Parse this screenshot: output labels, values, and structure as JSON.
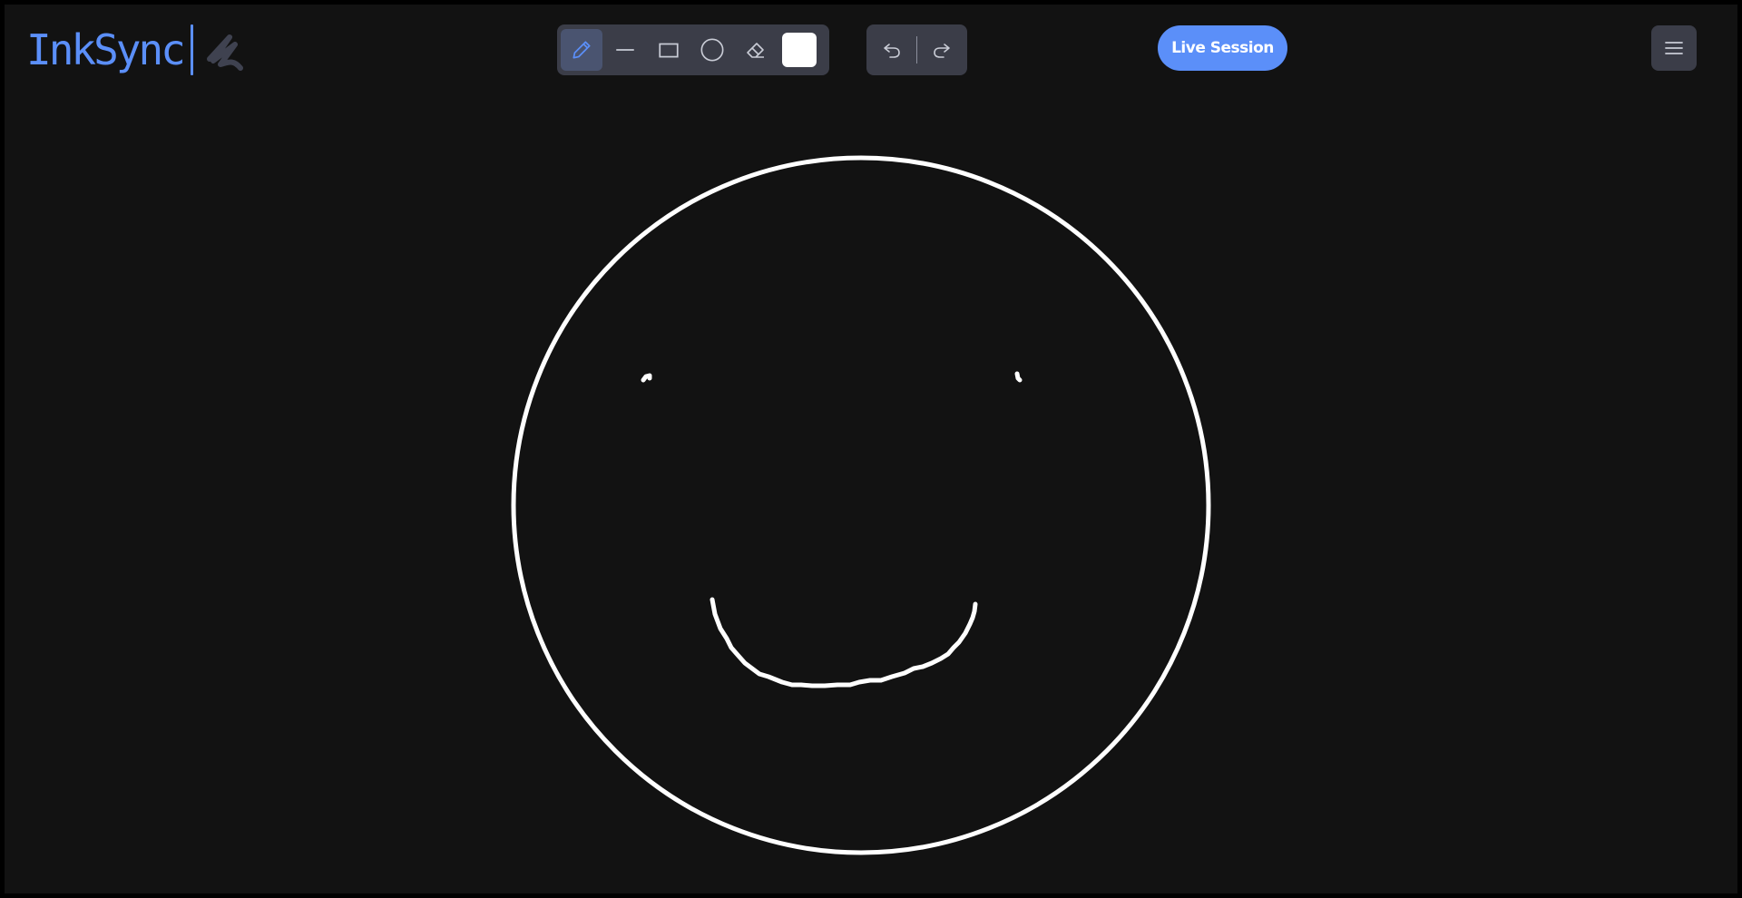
{
  "app": {
    "name": "InkSync",
    "accent_color": "#5b8ff9",
    "background_color": "#121212"
  },
  "toolbar": {
    "tools": [
      {
        "name": "pencil",
        "icon": "pencil-icon",
        "active": true
      },
      {
        "name": "line",
        "icon": "line-icon",
        "active": false
      },
      {
        "name": "rectangle",
        "icon": "rectangle-icon",
        "active": false
      },
      {
        "name": "circle",
        "icon": "circle-icon",
        "active": false
      },
      {
        "name": "eraser",
        "icon": "eraser-icon",
        "active": false
      }
    ],
    "current_color": "#ffffff"
  },
  "history": {
    "undo_icon": "undo-icon",
    "redo_icon": "redo-icon"
  },
  "session": {
    "live_label": "Live Session"
  },
  "menu": {
    "icon": "hamburger-menu-icon"
  }
}
